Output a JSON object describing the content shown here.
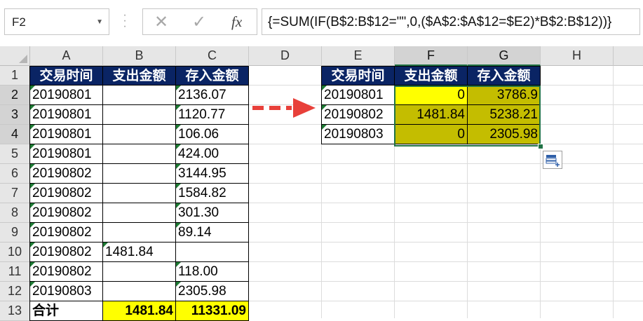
{
  "name_box": "F2",
  "formula_bar": {
    "cancel_icon": "x-icon",
    "enter_icon": "check-icon",
    "fx_label": "fx",
    "formula": "{=SUM(IF(B$2:B$12=\"\",0,($A$2:$A$12=$E2)*B$2:B$12))}"
  },
  "columns": [
    "A",
    "B",
    "C",
    "D",
    "E",
    "F",
    "G",
    "H"
  ],
  "rows": [
    "1",
    "2",
    "3",
    "4",
    "5",
    "6",
    "7",
    "8",
    "9",
    "10",
    "11",
    "12",
    "13"
  ],
  "left_table": {
    "headers": [
      "交易时间",
      "支出金额",
      "存入金额"
    ],
    "rows": [
      [
        "20190801",
        "",
        "2136.07"
      ],
      [
        "20190801",
        "",
        "1120.77"
      ],
      [
        "20190801",
        "",
        "106.06"
      ],
      [
        "20190801",
        "",
        "424.00"
      ],
      [
        "20190802",
        "",
        "3144.95"
      ],
      [
        "20190802",
        "",
        "1584.82"
      ],
      [
        "20190802",
        "",
        "301.30"
      ],
      [
        "20190802",
        "",
        "89.14"
      ],
      [
        "20190802",
        "1481.84",
        ""
      ],
      [
        "20190802",
        "",
        "118.00"
      ],
      [
        "20190803",
        "",
        "2305.98"
      ]
    ],
    "total": [
      "合计",
      "1481.84",
      "11331.09"
    ]
  },
  "right_table": {
    "headers": [
      "交易时间",
      "支出金额",
      "存入金额"
    ],
    "rows": [
      [
        "20190801",
        "0",
        "3786.9"
      ],
      [
        "20190802",
        "1481.84",
        "5238.21"
      ],
      [
        "20190803",
        "0",
        "2305.98"
      ]
    ]
  },
  "colors": {
    "header_fill": "#0a2464",
    "yellow": "#ffff00",
    "olive": "#c4bd00",
    "arrow": "#e8403a",
    "selection": "#217346"
  }
}
